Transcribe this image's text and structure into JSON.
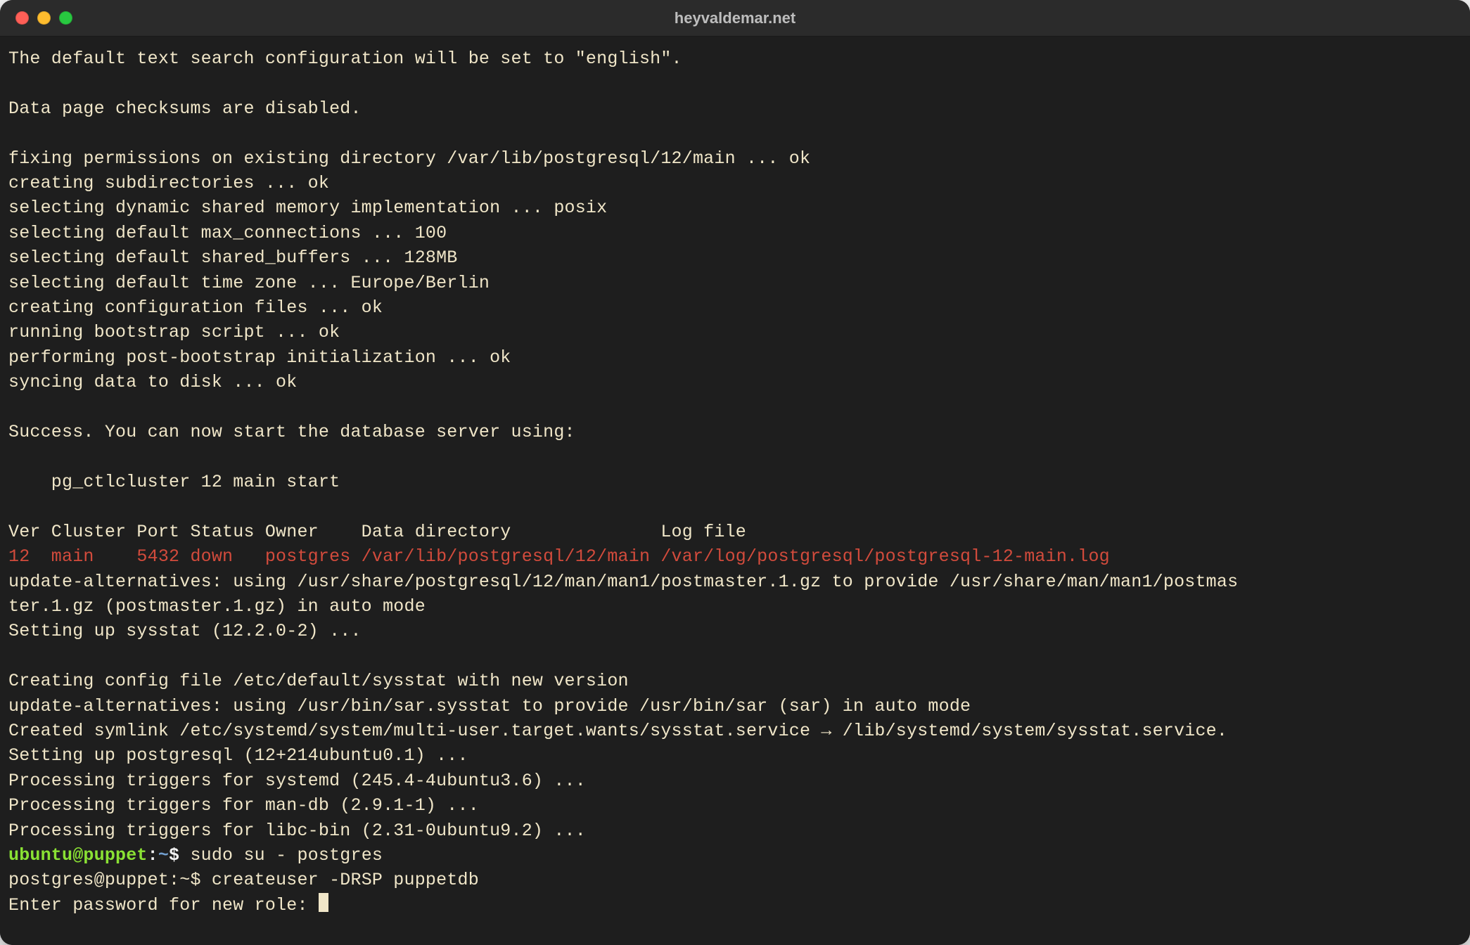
{
  "window": {
    "title": "heyvaldemar.net"
  },
  "lines": {
    "l00": "The default text search configuration will be set to \"english\".",
    "l01": "",
    "l02": "Data page checksums are disabled.",
    "l03": "",
    "l04": "fixing permissions on existing directory /var/lib/postgresql/12/main ... ok",
    "l05": "creating subdirectories ... ok",
    "l06": "selecting dynamic shared memory implementation ... posix",
    "l07": "selecting default max_connections ... 100",
    "l08": "selecting default shared_buffers ... 128MB",
    "l09": "selecting default time zone ... Europe/Berlin",
    "l10": "creating configuration files ... ok",
    "l11": "running bootstrap script ... ok",
    "l12": "performing post-bootstrap initialization ... ok",
    "l13": "syncing data to disk ... ok",
    "l14": "",
    "l15": "Success. You can now start the database server using:",
    "l16": "",
    "l17": "    pg_ctlcluster 12 main start",
    "l18": "",
    "l19": "Ver Cluster Port Status Owner    Data directory              Log file",
    "l20": "12  main    5432 down   postgres /var/lib/postgresql/12/main /var/log/postgresql/postgresql-12-main.log",
    "l21": "update-alternatives: using /usr/share/postgresql/12/man/man1/postmaster.1.gz to provide /usr/share/man/man1/postmas",
    "l22": "ter.1.gz (postmaster.1.gz) in auto mode",
    "l23": "Setting up sysstat (12.2.0-2) ...",
    "l24": "",
    "l25": "Creating config file /etc/default/sysstat with new version",
    "l26": "update-alternatives: using /usr/bin/sar.sysstat to provide /usr/bin/sar (sar) in auto mode",
    "l27": "Created symlink /etc/systemd/system/multi-user.target.wants/sysstat.service → /lib/systemd/system/sysstat.service.",
    "l28": "Setting up postgresql (12+214ubuntu0.1) ...",
    "l29": "Processing triggers for systemd (245.4-4ubuntu3.6) ...",
    "l30": "Processing triggers for man-db (2.9.1-1) ...",
    "l31": "Processing triggers for libc-bin (2.31-0ubuntu9.2) ..."
  },
  "prompt1": {
    "user_host": "ubuntu@puppet",
    "sep": ":",
    "path": "~",
    "dollar": "$ ",
    "cmd": "sudo su - postgres"
  },
  "prompt2": {
    "prefix": "postgres@puppet:~$ ",
    "cmd": "createuser -DRSP puppetdb"
  },
  "pwline": {
    "text": "Enter password for new role: "
  }
}
